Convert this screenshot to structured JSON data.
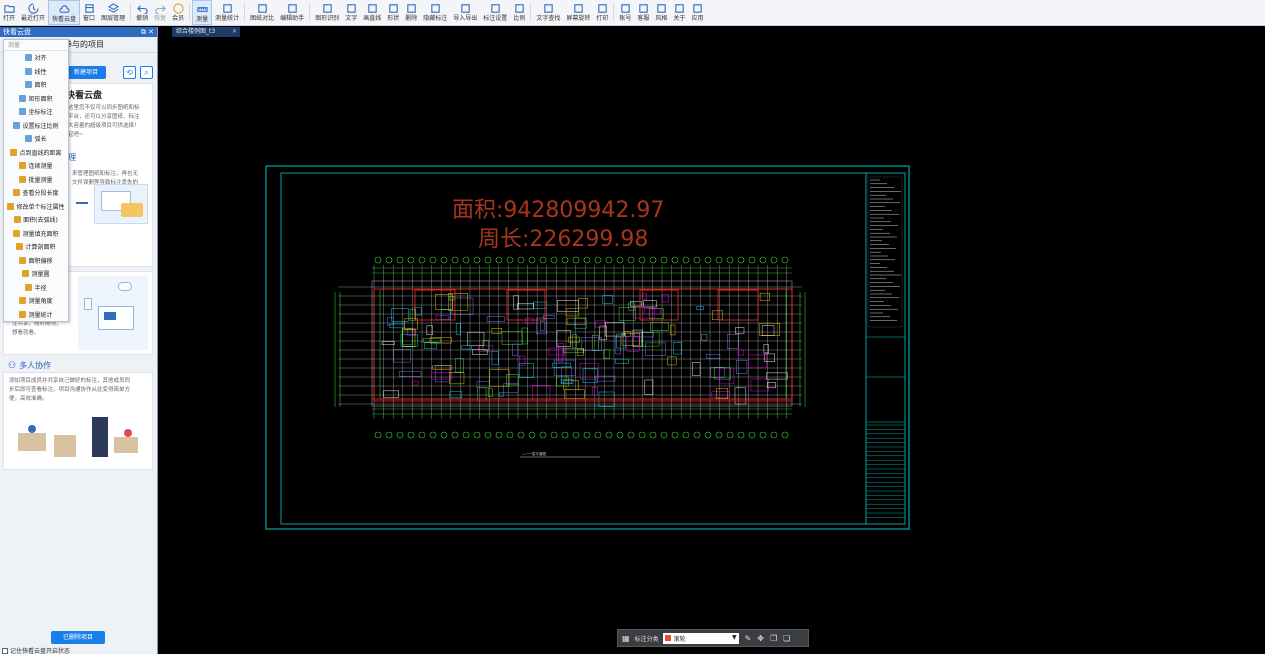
{
  "toolbar": {
    "items": [
      {
        "label": "打开",
        "icon": "folder-icon"
      },
      {
        "label": "最近打开",
        "icon": "history-icon"
      },
      {
        "label": "快看云盘",
        "icon": "cloud-icon"
      },
      {
        "label": "窗口",
        "icon": "window-icon"
      },
      {
        "label": "图层管理",
        "icon": "layers-icon"
      },
      {
        "label": "撤销",
        "icon": "undo-icon"
      },
      {
        "label": "恢复",
        "icon": "redo-icon"
      },
      {
        "label": "会员",
        "icon": "vip-icon"
      },
      {
        "label": "测量",
        "icon": "measure-icon"
      },
      {
        "label": "测量统计",
        "icon": "measure-stats-icon"
      },
      {
        "label": "图纸对比",
        "icon": "compare-icon"
      },
      {
        "label": "编辑助手",
        "icon": "edit-assistant-icon"
      },
      {
        "label": "图形识别",
        "icon": "shape-recognition-icon"
      },
      {
        "label": "文字",
        "icon": "text-icon"
      },
      {
        "label": "画直线",
        "icon": "line-icon"
      },
      {
        "label": "形状",
        "icon": "shape-icon"
      },
      {
        "label": "删除",
        "icon": "eraser-icon"
      },
      {
        "label": "隐藏标注",
        "icon": "hide-annotation-icon"
      },
      {
        "label": "导入导出",
        "icon": "import-export-icon"
      },
      {
        "label": "标注设置",
        "icon": "annotation-settings-icon"
      },
      {
        "label": "比例",
        "icon": "scale-icon"
      },
      {
        "label": "文字查找",
        "icon": "text-search-icon"
      },
      {
        "label": "屏幕旋转",
        "icon": "rotate-screen-icon"
      },
      {
        "label": "打印",
        "icon": "print-icon"
      },
      {
        "label": "账号",
        "icon": "account-icon"
      },
      {
        "label": "客服",
        "icon": "headset-icon"
      },
      {
        "label": "风格",
        "icon": "style-icon"
      },
      {
        "label": "关于",
        "icon": "info-icon"
      },
      {
        "label": "应用",
        "icon": "apps-icon"
      }
    ],
    "expand_icon": "▼"
  },
  "panel": {
    "title": "快看云盘",
    "title_buttons": "⧉ ✕",
    "subtitle": "参与的项目",
    "new_project_label": "新建项目",
    "sync_icon": "⟲",
    "search_icon": "⌕",
    "intro_title": "快看云盘",
    "intro_text": [
      "这里您不仅可以同步图纸和标",
      "平台，还可以分享图纸、标注",
      "大容量的超级项目可供选择！",
      "起吧~"
    ],
    "section2_title": "理",
    "section2_text": [
      "来管理图纸和标注，再也无",
      "文件误删等导致标注丢失的"
    ],
    "section3_text": [
      "注共享，随时随地，",
      "想看就看。"
    ],
    "collab_title": "多人协作",
    "collab_text": [
      "添加项目成员并共享自己做好的标注，其他成员同",
      "步后即可查看标注。项目沟通协作从此变得简单方",
      "便，高效准确。"
    ],
    "deleted_projects_label": "已删除项目",
    "auto_open_label": "记住快看云盘开启状态"
  },
  "menu": {
    "search_placeholder": "测量",
    "items": [
      {
        "label": "对齐",
        "color": "#6aa0d8"
      },
      {
        "label": "线性",
        "color": "#6aa0d8"
      },
      {
        "label": "面积",
        "color": "#6aa0d8"
      },
      {
        "label": "矩形面积",
        "color": "#6aa0d8"
      },
      {
        "label": "坐标标注",
        "color": "#6aa0d8"
      },
      {
        "label": "设置标注比例",
        "color": "#6aa0d8"
      },
      {
        "label": "弧长",
        "color": "#6aa0d8"
      },
      {
        "label": "点到直线的距离",
        "color": "#e0a22a"
      },
      {
        "label": "连续测量",
        "color": "#e0a22a"
      },
      {
        "label": "批量测量",
        "color": "#e0a22a"
      },
      {
        "label": "查看分段长度",
        "color": "#e0a22a"
      },
      {
        "label": "修改单个标注属性",
        "color": "#e0a22a"
      },
      {
        "label": "面积(去弧线)",
        "color": "#e0a22a"
      },
      {
        "label": "测量填充面积",
        "color": "#e0a22a"
      },
      {
        "label": "计算剖面积",
        "color": "#e0a22a"
      },
      {
        "label": "面积偏移",
        "color": "#e0a22a"
      },
      {
        "label": "测量圆",
        "color": "#e0a22a"
      },
      {
        "label": "半径",
        "color": "#e0a22a"
      },
      {
        "label": "测量角度",
        "color": "#e0a22a"
      },
      {
        "label": "测量统计",
        "color": "#e0a22a"
      }
    ]
  },
  "document": {
    "tab_label": "综合楼例图_t3",
    "tab_close": "✕",
    "area_text": "面积:942809942.97",
    "perimeter_text": "周长:226299.98",
    "plan_caption": "—~一层平面图"
  },
  "floatbar": {
    "category_label": "标注分类",
    "category_value": "滚轮",
    "category_color": "#e0522a"
  },
  "colors": {
    "accent": "#1a7ee8",
    "panel_header": "#2f6bbf",
    "drawing_frame": "#00c8c8",
    "measure_text": "#a8351c"
  }
}
